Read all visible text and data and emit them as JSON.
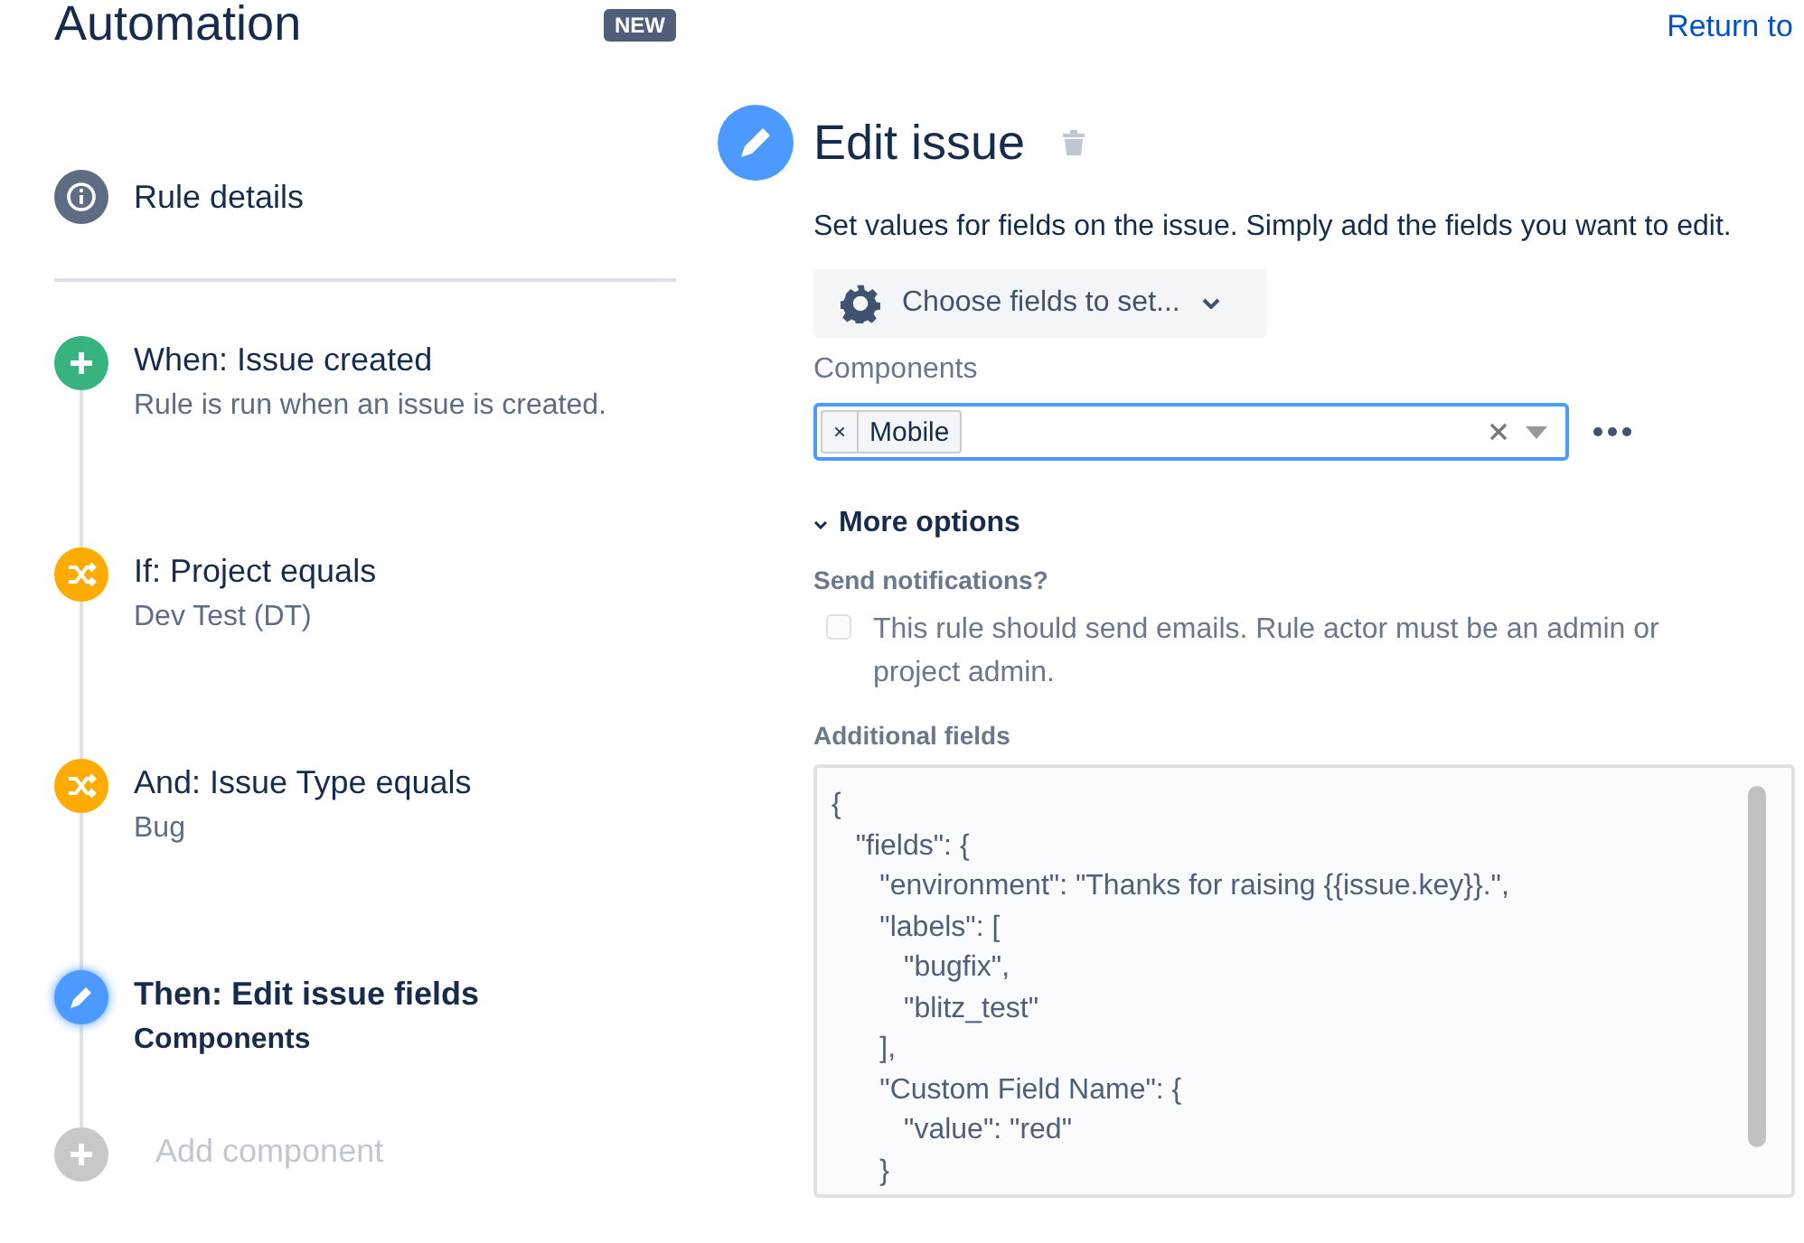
{
  "header": {
    "title": "Automation",
    "badge": "NEW",
    "return_link": "Return to"
  },
  "rule_details": {
    "label": "Rule details"
  },
  "steps": [
    {
      "kind": "trigger",
      "title": "When: Issue created",
      "subtitle": "Rule is run when an issue is created.",
      "selected": false
    },
    {
      "kind": "condition",
      "title": "If: Project equals",
      "subtitle": "Dev Test (DT)",
      "selected": false
    },
    {
      "kind": "condition",
      "title": "And: Issue Type equals",
      "subtitle": "Bug",
      "selected": false
    },
    {
      "kind": "action",
      "title": "Then: Edit issue fields",
      "subtitle": "Components",
      "selected": true
    },
    {
      "kind": "add",
      "title": "Add component",
      "selected": false
    }
  ],
  "editor": {
    "title": "Edit issue",
    "description": "Set values for fields on the issue. Simply add the fields you want to edit.",
    "choose_button": "Choose fields to set...",
    "components_label": "Components",
    "components_tags": [
      "Mobile"
    ],
    "tag_remove": "×",
    "more_options": "More options",
    "notifications_label": "Send notifications?",
    "notify_checkbox": {
      "label": "This rule should send emails. Rule actor must be an admin or project admin.",
      "checked": false
    },
    "additional_label": "Additional fields",
    "additional_value": "{\n   \"fields\": {\n      \"environment\": \"Thanks for raising {{issue.key}}.\",\n      \"labels\": [\n         \"bugfix\",\n         \"blitz_test\"\n      ],\n      \"Custom Field Name\": {\n         \"value\": \"red\"\n      }"
  }
}
